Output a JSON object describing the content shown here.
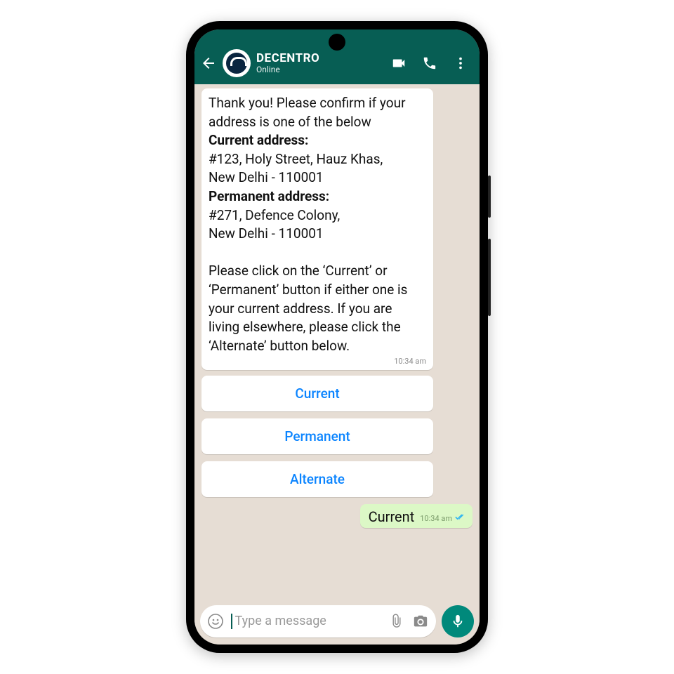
{
  "header": {
    "name": "DECENTRO",
    "status": "Online"
  },
  "message": {
    "line1": "Thank you! Please confirm if your address is one of the below",
    "current_label": "Current address:",
    "current_addr_l1": "#123, Holy Street, Hauz Khas,",
    "current_addr_l2": "New Delhi - 110001",
    "perm_label": "Permanent address:",
    "perm_addr_l1": "#271, Defence Colony,",
    "perm_addr_l2": "New Delhi - 110001",
    "instruction": "Please click on the ‘Current’ or ‘Permanent’ button if either one is your current address. If you are living elsewhere, please click the ‘Alternate’ button below.",
    "time": "10:34 am"
  },
  "buttons": {
    "current": "Current",
    "permanent": "Permanent",
    "alternate": "Alternate"
  },
  "reply": {
    "text": "Current",
    "time": "10:34 am"
  },
  "input": {
    "placeholder": "Type a message"
  }
}
